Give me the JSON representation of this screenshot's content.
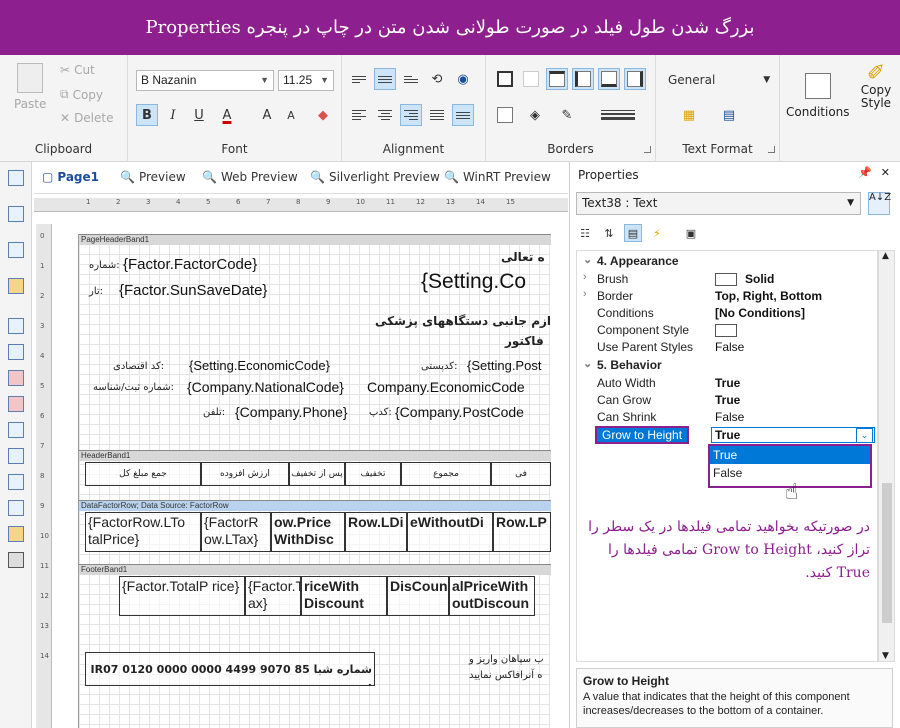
{
  "banner": {
    "title": "بزرگ شدن طول فیلد در صورت طولانی شدن متن در چاپ در پنجره Properties"
  },
  "ribbon": {
    "clipboard": {
      "label": "Clipboard",
      "paste": "Paste",
      "cut": "Cut",
      "copy": "Copy",
      "delete": "Delete"
    },
    "font": {
      "label": "Font",
      "family": "B Nazanin",
      "size": "11.25",
      "bold": "B",
      "italic": "I",
      "underline": "U",
      "color": "A",
      "grow": "A",
      "shrink": "A"
    },
    "alignment": {
      "label": "Alignment"
    },
    "borders": {
      "label": "Borders"
    },
    "text_format": {
      "label": "Text Format",
      "format": "General"
    },
    "conditions": {
      "label": "Conditions"
    },
    "copy_style": {
      "label": "Copy Style"
    }
  },
  "tabs": [
    {
      "label": "Page1"
    },
    {
      "label": "Preview"
    },
    {
      "label": "Web Preview"
    },
    {
      "label": "Silverlight Preview"
    },
    {
      "label": "WinRT Preview"
    }
  ],
  "ruler": {
    "h": [
      "1",
      "2",
      "3",
      "4",
      "5",
      "6",
      "7",
      "8",
      "9",
      "10",
      "11",
      "12",
      "13",
      "14",
      "15"
    ],
    "v": [
      "0",
      "1",
      "2",
      "3",
      "4",
      "5",
      "6",
      "7",
      "8",
      "9",
      "10",
      "11",
      "12",
      "13",
      "14"
    ]
  },
  "report": {
    "bands": {
      "page_header": "PageHeaderBand1",
      "header": "HeaderBand1",
      "data": "DataFactorRow; Data Source: FactorRow",
      "footer": "FooterBand1"
    },
    "fields": {
      "factor_code": "{Factor.FactorCode}",
      "factor_code_label": ":شماره",
      "save_date": "{Factor.SunSaveDate}",
      "save_date_label": ":تار",
      "title_top": "ه تعالی",
      "setting_co": "{Setting.Co",
      "medical": "ازم جانبی دستگاههای پزشکی",
      "invoice": "فاکتور",
      "economic_code": "{Setting.EconomicCode}",
      "economic_code_label": ":کد اقتصادی",
      "post_code": "{Setting.Post",
      "post_code_label": ":کدپستی",
      "national_code": "{Company.NationalCode}",
      "national_code_label": ":شماره ثبت/شناسه",
      "company_economic": "Company.EconomicCode",
      "company_phone": "{Company.Phone}",
      "company_phone_label": ":تلفن",
      "company_post": "{Company.PostCode",
      "company_post_label": ":کدپ",
      "shaba": "شماره شبا  IR07 0120 0000 0000 4499 9070 85 :",
      "bank_text": "ب سپاهان واریز و",
      "bank_text2": "ه آنرافاکس نمایید"
    },
    "header_cells": [
      "فی",
      "مجموع",
      "تخفیف",
      "پس از تخفیف",
      "ارزش افزوده",
      "جمع مبلغ کل"
    ],
    "data_cells": [
      "Row.LP",
      "eWithoutDi",
      "Row.LDi",
      "ow.Price WithDisc",
      "{FactorR ow.LTax}",
      "{FactorRow.LTo talPrice}"
    ],
    "footer_cells": [
      "alPriceWith outDiscoun",
      "DisCoun",
      "riceWith Discount",
      "{Factor.T ax}",
      "{Factor.TotalP rice}"
    ]
  },
  "properties": {
    "title": "Properties",
    "pin": "📌",
    "close": "✕",
    "object": "Text38 : Text",
    "sort_az": "A↓Z",
    "categories": [
      {
        "name": "4. Appearance",
        "rows": [
          {
            "name": "Brush",
            "value": "Solid"
          },
          {
            "name": "Border",
            "value": "Top, Right, Bottom"
          },
          {
            "name": "Conditions",
            "value": "[No Conditions]"
          },
          {
            "name": "Component Style",
            "value": ""
          },
          {
            "name": "Use Parent Styles",
            "value": "False"
          }
        ]
      },
      {
        "name": "5. Behavior",
        "rows": [
          {
            "name": "Auto Width",
            "value": "True"
          },
          {
            "name": "Can Grow",
            "value": "True"
          },
          {
            "name": "Can Shrink",
            "value": "False"
          },
          {
            "name": "Grow to Height",
            "value": "True"
          }
        ]
      }
    ],
    "dropdown_options": [
      "True",
      "False"
    ],
    "note": "در صورتیکه بخواهید تمامی فیلدها در یک سطر را تراز کنید، Grow to Height تمامی فیلدها را True کنید.",
    "description": {
      "title": "Grow to Height",
      "text": "A value that indicates that the height of this component increases/decreases to the bottom of a container."
    }
  }
}
